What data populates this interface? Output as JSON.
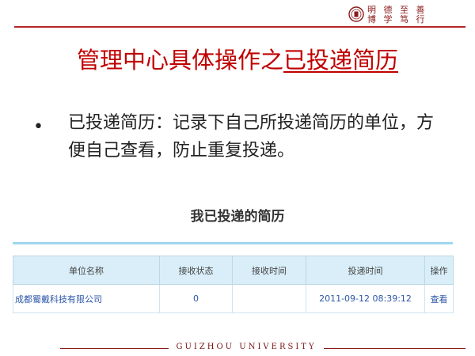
{
  "header": {
    "motto_line1": "明 德 至 善",
    "motto_line2": "博 学 笃 行"
  },
  "title": {
    "prefix": "管理中心具体操作之",
    "underlined": "已投递简历"
  },
  "bullet": {
    "text": "已投递简历：记录下自己所投递简历的单位，方便自己查看，防止重复投递。"
  },
  "embedded": {
    "heading": "我已投递的简历",
    "columns": [
      "单位名称",
      "接收状态",
      "接收时间",
      "投递时间",
      "操作"
    ],
    "rows": [
      {
        "company": "成都蜀戴科技有限公司",
        "status": "0",
        "received_time": "",
        "sent_time": "2011-09-12 08:39:12",
        "action": "查看"
      }
    ]
  },
  "footer": {
    "text": "GUIZHOU UNIVERSITY"
  },
  "colors": {
    "accent": "#c00000",
    "brand_dark": "#8b1a1a",
    "table_header_bg": "#d9eef8",
    "link_blue": "#2d56a8"
  }
}
